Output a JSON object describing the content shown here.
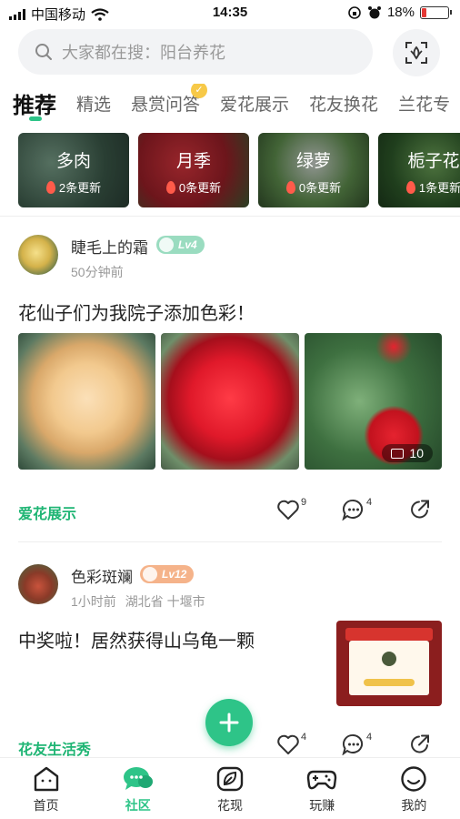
{
  "status_bar": {
    "carrier": "中国移动",
    "time": "14:35",
    "battery": "18%",
    "battery_level": 0.18,
    "battery_color": "#e53935"
  },
  "search": {
    "placeholder": "大家都在搜：阳台养花",
    "icon": "search-icon",
    "scan_icon": "scan-icon"
  },
  "tabs": [
    {
      "label": "推荐",
      "active": true
    },
    {
      "label": "精选"
    },
    {
      "label": "悬赏问答",
      "badge_icon": "reward-badge-icon"
    },
    {
      "label": "爱花展示"
    },
    {
      "label": "花友换花"
    },
    {
      "label": "兰花专"
    }
  ],
  "categories": [
    {
      "name": "多肉",
      "updates": "2条更新"
    },
    {
      "name": "月季",
      "updates": "0条更新"
    },
    {
      "name": "绿萝",
      "updates": "0条更新"
    },
    {
      "name": "栀子花",
      "updates": "1条更新"
    }
  ],
  "posts": [
    {
      "user": "睫毛上的霜",
      "level": "Lv4",
      "level_color": "#9adcc0",
      "time": "50分钟前",
      "text": "花仙子们为我院子添加色彩！",
      "image_count": "10",
      "topic": "爱花展示",
      "likes": "9",
      "comments": "4"
    },
    {
      "user": "色彩斑斓",
      "level": "Lv12",
      "level_color": "#f5b38a",
      "time": "1小时前",
      "location": "湖北省 十堰市",
      "text": "中奖啦！居然获得山乌龟一颗",
      "topic": "花友生活秀",
      "likes": "4",
      "comments": "4"
    }
  ],
  "fab": {
    "icon": "plus-icon"
  },
  "accent_color": "#2ec488",
  "nav": [
    {
      "label": "首页",
      "icon": "home-icon"
    },
    {
      "label": "社区",
      "icon": "community-icon",
      "active": true
    },
    {
      "label": "花现",
      "icon": "leaf-icon"
    },
    {
      "label": "玩赚",
      "icon": "gamepad-icon"
    },
    {
      "label": "我的",
      "icon": "profile-icon"
    }
  ]
}
